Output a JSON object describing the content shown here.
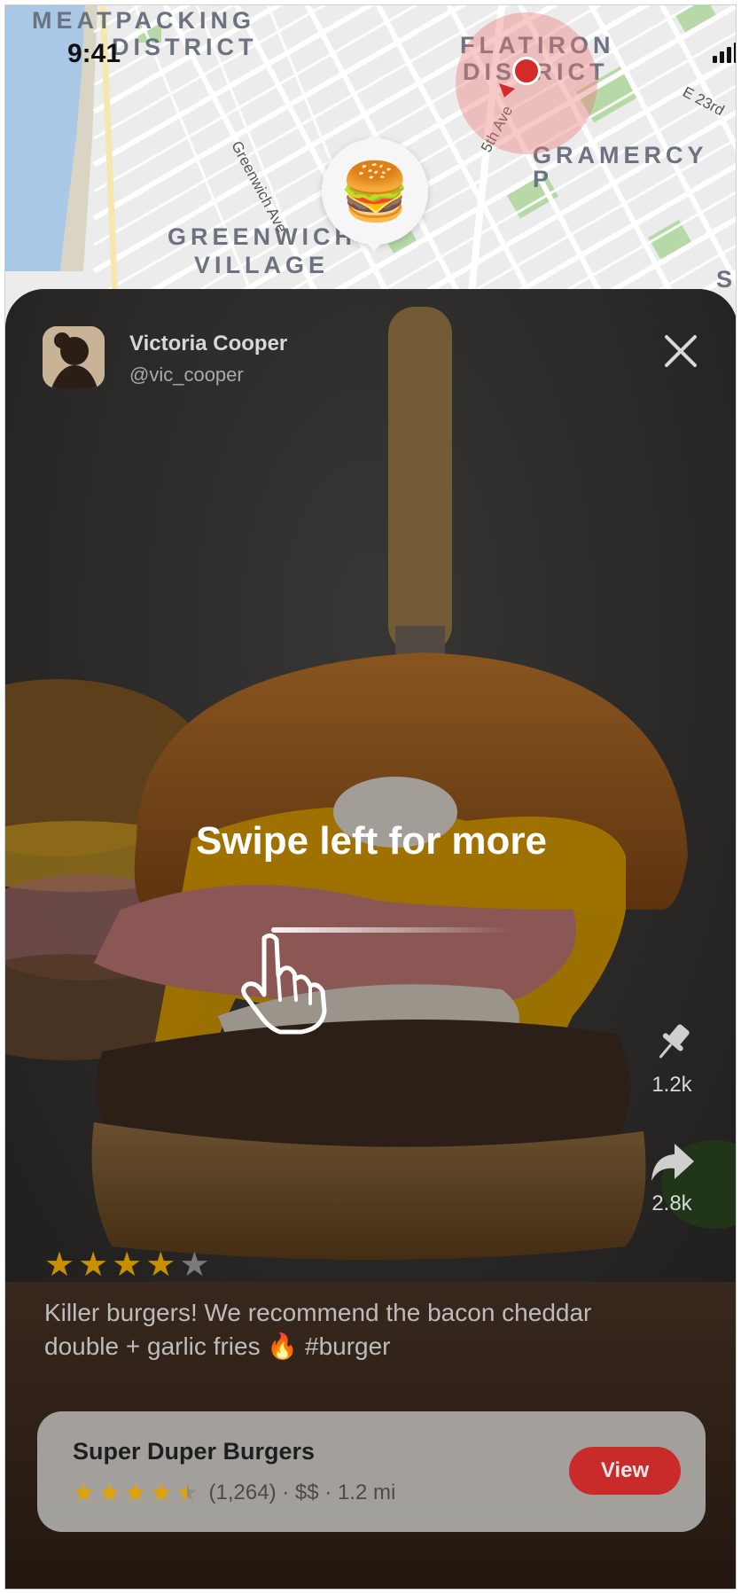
{
  "status_bar": {
    "time": "9:41"
  },
  "map": {
    "neighborhoods": {
      "meatpacking_line1": "MEATPACKING",
      "meatpacking_line2": "DISTRICT",
      "flatiron_line1": "FLATIRON",
      "flatiron_line2": "DISTRICT",
      "gramercy": "GRAMERCY P",
      "greenwich_line1": "GREENWICH",
      "greenwich_line2": "VILLAGE"
    },
    "streets": {
      "greenwich_ave": "Greenwich Ave",
      "fifth_ave": "5th Ave",
      "e23rd": "E 23rd",
      "edge_s": "S"
    },
    "pin_emoji": "🍔"
  },
  "post": {
    "user": {
      "name": "Victoria Cooper",
      "handle": "@vic_cooper"
    },
    "swipe_hint": "Swipe left for more",
    "actions": [
      {
        "icon": "pin-icon",
        "count": "1.2k"
      },
      {
        "icon": "share-icon",
        "count": "2.8k"
      }
    ],
    "rating": {
      "filled": 4,
      "total": 5
    },
    "caption": "Killer burgers! We recommend the bacon cheddar double + garlic fries 🔥 #burger"
  },
  "restaurant": {
    "name": "Super Duper Burgers",
    "rating_stars": 4.5,
    "meta": "(1,264) · $$ · 1.2 mi",
    "view_label": "View"
  },
  "colors": {
    "accent": "#c92b2b",
    "star": "#e2a200",
    "star_empty": "#8a8a8a"
  }
}
